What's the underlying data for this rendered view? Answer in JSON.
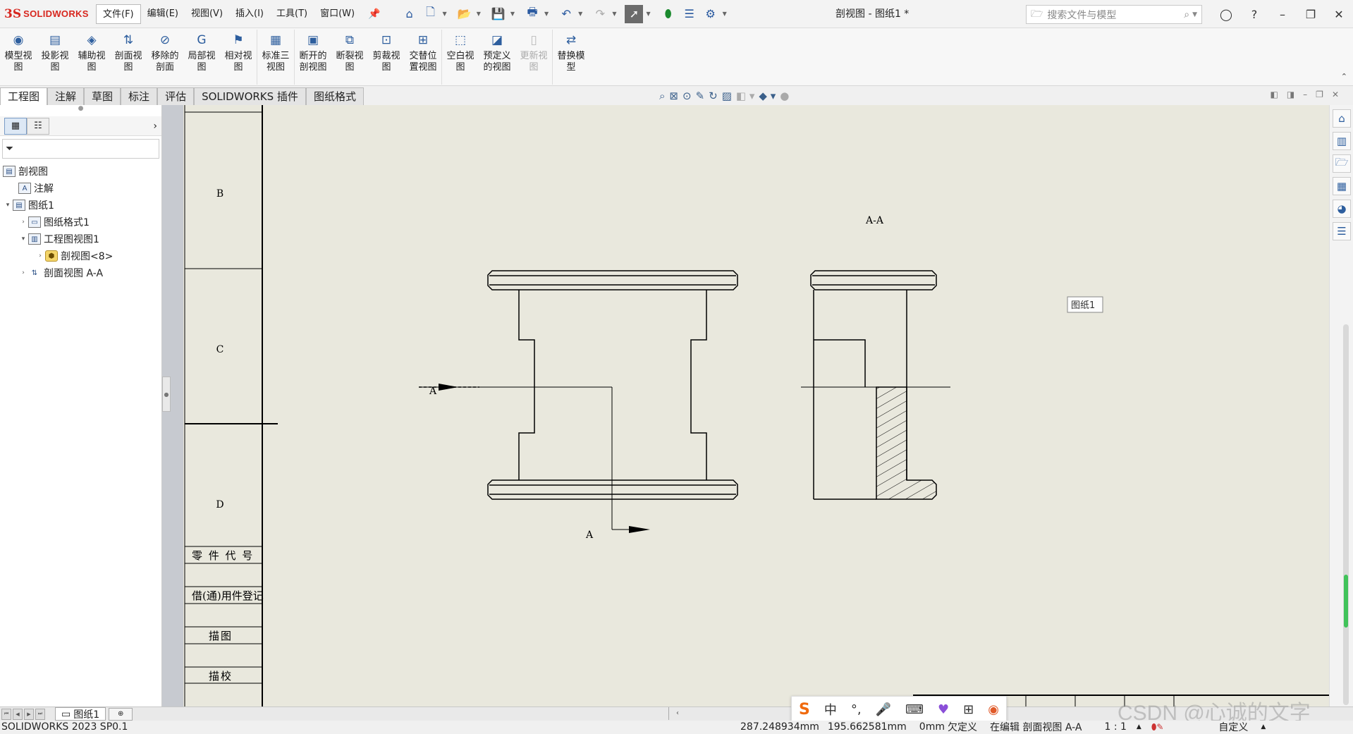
{
  "app": {
    "logo_mark": "3S",
    "logo_text": "SOLIDWORKS",
    "doc_title": "剖视图 - 图纸1 *"
  },
  "menu": [
    "文件(F)",
    "编辑(E)",
    "视图(V)",
    "插入(I)",
    "工具(T)",
    "窗口(W)"
  ],
  "search": {
    "placeholder": "搜索文件与模型"
  },
  "ribbon": {
    "groups": [
      [
        "模型视\n图",
        "投影视\n图",
        "辅助视\n图",
        "剖面视\n图",
        "移除的\n剖面",
        "局部视\n图",
        "相对视\n图"
      ],
      [
        "标准三\n视图"
      ],
      [
        "断开的\n剖视图",
        "断裂视\n图",
        "剪裁视\n图",
        "交替位\n置视图"
      ],
      [
        "空白视\n图",
        "预定义\n的视图",
        "更新视\n图"
      ],
      [
        "替换模\n型"
      ]
    ]
  },
  "tabs": [
    "工程图",
    "注解",
    "草图",
    "标注",
    "评估",
    "SOLIDWORKS 插件",
    "图纸格式"
  ],
  "tree": {
    "items": [
      {
        "label": "剖视图",
        "level": 0,
        "twisty": "",
        "icon": "drawing-icon"
      },
      {
        "label": "注解",
        "level": 1,
        "twisty": "",
        "icon": "annotation-icon"
      },
      {
        "label": "图纸1",
        "level": 0,
        "twisty": "▾",
        "icon": "sheet-icon"
      },
      {
        "label": "图纸格式1",
        "level": 1,
        "twisty": "›",
        "icon": "sheet-format-icon"
      },
      {
        "label": "工程图视图1",
        "level": 1,
        "twisty": "▾",
        "icon": "drawing-view-icon"
      },
      {
        "label": "剖视图<8>",
        "level": 2,
        "twisty": "›",
        "icon": "part-icon"
      },
      {
        "label": "剖面视图 A-A",
        "level": 1,
        "twisty": "›",
        "icon": "section-view-icon"
      }
    ]
  },
  "drawing": {
    "zones": [
      "B",
      "C",
      "D"
    ],
    "title_block": [
      "零 件 代 号",
      "借(通)用件登记",
      "描图",
      "描校"
    ],
    "section_label": "A-A",
    "arrow_label_top": "A",
    "arrow_label_bottom": "A",
    "sheet_tooltip": "图纸1"
  },
  "bottom": {
    "sheet_tab": "图纸1"
  },
  "status": {
    "version": "SOLIDWORKS 2023 SP0.1",
    "x": "287.248934mm",
    "y": "195.662581mm",
    "z": "0mm",
    "define": "欠定义",
    "editing": "在编辑 剖面视图 A-A",
    "scale": "1 : 1",
    "units": "自定义"
  },
  "ime": {
    "mode": "中"
  },
  "watermark": "CSDN @心诚的文字"
}
